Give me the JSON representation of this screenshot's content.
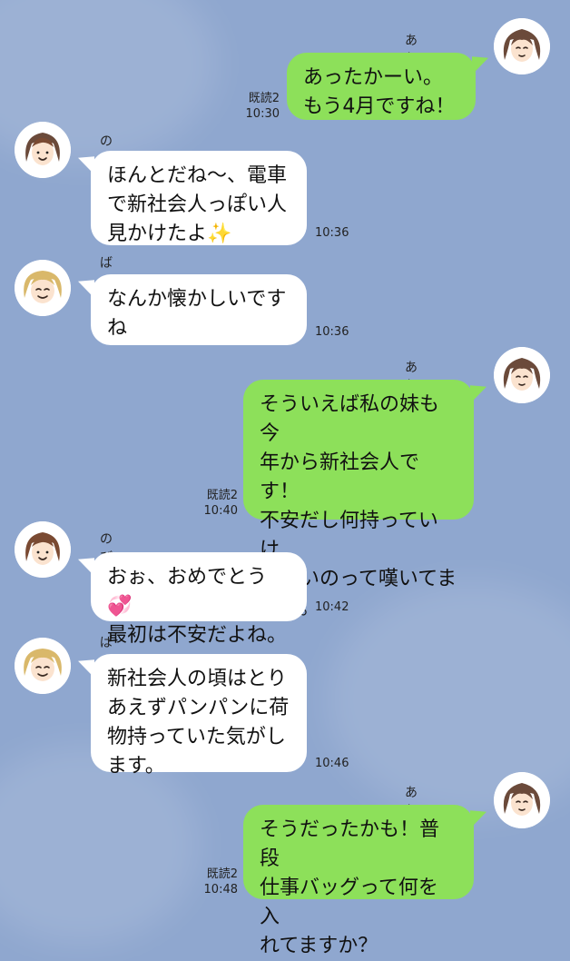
{
  "messages": [
    {
      "side": "right",
      "name": "あむさん",
      "text": "あったかーい。\nもう4月ですね！",
      "read": "既読2",
      "time": "10:30",
      "avatar": "amu-avatar"
    },
    {
      "side": "left",
      "name": "のび子",
      "text": "ほんとだね〜、電車\nで新社会人っぽい人\n見かけたよ✨",
      "time": "10:36",
      "avatar": "nobiko-avatar"
    },
    {
      "side": "left",
      "name": "ばっさー",
      "text": "なんか懐かしいです\nね",
      "time": "10:36",
      "avatar": "bassa-avatar"
    },
    {
      "side": "right",
      "name": "あむさん",
      "text": "そういえば私の妹も今\n年から新社会人です！\n不安だし何持っていけ\nばいいのって嘆いてま\nした。",
      "read": "既読2",
      "time": "10:40",
      "avatar": "amu-avatar"
    },
    {
      "side": "left",
      "name": "のび子",
      "text": "おぉ、おめでとう💞\n最初は不安だよね。",
      "time": "10:42",
      "avatar": "nobiko-avatar"
    },
    {
      "side": "left",
      "name": "ばっさー",
      "text": "新社会人の頃はとり\nあえずパンパンに荷\n物持っていた気がし\nます。",
      "time": "10:46",
      "avatar": "bassa-avatar"
    },
    {
      "side": "right",
      "name": "あむさん",
      "text": "そうだったかも！普段\n仕事バッグって何を入\nれてますか？",
      "read": "既読2",
      "time": "10:48",
      "avatar": "amu-avatar"
    }
  ]
}
